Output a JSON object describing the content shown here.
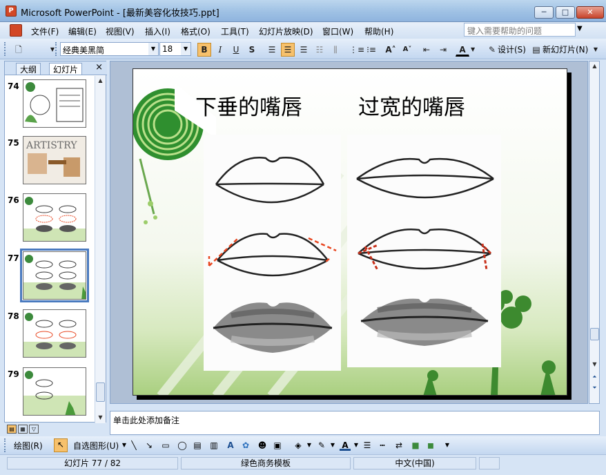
{
  "window": {
    "app_icon": "powerpoint-icon",
    "title": "Microsoft PowerPoint - [最新美容化妆技巧.ppt]",
    "min": "─",
    "max": "□",
    "close": "✕"
  },
  "menu": {
    "items": [
      "文件(F)",
      "编辑(E)",
      "视图(V)",
      "插入(I)",
      "格式(O)",
      "工具(T)",
      "幻灯片放映(D)",
      "窗口(W)",
      "帮助(H)"
    ],
    "help_placeholder": "键入需要帮助的问题"
  },
  "toolbar": {
    "font_name": "经典美黑简",
    "font_size": "18",
    "bold": "B",
    "italic": "I",
    "underline": "U",
    "shadow": "S",
    "design_label": "设计(S)",
    "new_slide_label": "新幻灯片(N)"
  },
  "panel": {
    "tab_outline": "大纲",
    "tab_slides": "幻灯片",
    "close": "×",
    "slides": [
      {
        "num": "74",
        "selected": false
      },
      {
        "num": "75",
        "selected": false
      },
      {
        "num": "76",
        "selected": false
      },
      {
        "num": "77",
        "selected": true
      },
      {
        "num": "78",
        "selected": false
      },
      {
        "num": "79",
        "selected": false
      }
    ],
    "thumb_75_brand": "ARTISTRY"
  },
  "slide": {
    "title_left": "下垂的嘴唇",
    "title_right": "过宽的嘴唇",
    "colors": {
      "leaf_green": "#2f8f2f",
      "guide_red": "#e8451f",
      "bg_green": "#b9d98e"
    }
  },
  "notes": {
    "placeholder": "单击此处添加备注"
  },
  "drawbar": {
    "draw": "绘图(R)",
    "autoshapes": "自选图形(U)"
  },
  "status": {
    "slide_info": "幻灯片 77 / 82",
    "template": "绿色商务模板",
    "language": "中文(中国)"
  }
}
